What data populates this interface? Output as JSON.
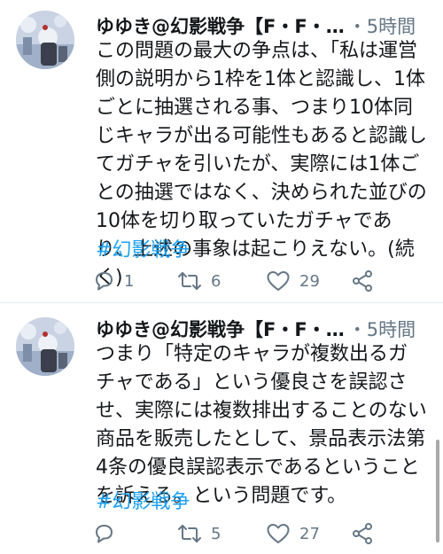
{
  "colors": {
    "text": "#14171a",
    "secondary": "#657786",
    "hashtag": "#1da1f2",
    "divider": "#e6ecf0"
  },
  "tweets": [
    {
      "author": "ゆゆき@幻影戦争【F・F・…",
      "time": "5時間",
      "separator": "・",
      "text": "この問題の最大の争点は、「私は運営側の説明から1枠を1体と認識し、1体ごとに抽選される事、つまり10体同じキャラが出る可能性もあると認識してガチャを引いたが、実際には1体ごとの抽選ではなく、決められた並びの10体を切り取っていたガチャであり、上述の事象は起こりえない。(続く)",
      "hashtag": "#幻影戦争",
      "reply_count": "1",
      "retweet_count": "6",
      "like_count": "29",
      "icons": [
        "reply-icon",
        "retweet-icon",
        "like-icon",
        "share-icon"
      ]
    },
    {
      "author": "ゆゆき@幻影戦争【F・F・…",
      "time": "5時間",
      "separator": "・",
      "text": "つまり「特定のキャラが複数出るガチャである」という優良さを誤認させ、実際には複数排出することのない商品を販売したとして、景品表示法第4条の優良誤認表示であるということを訴える。という問題です。",
      "hashtag": "#幻影戦争",
      "reply_count": "",
      "retweet_count": "5",
      "like_count": "27",
      "icons": [
        "reply-icon",
        "retweet-icon",
        "like-icon",
        "share-icon"
      ]
    }
  ]
}
